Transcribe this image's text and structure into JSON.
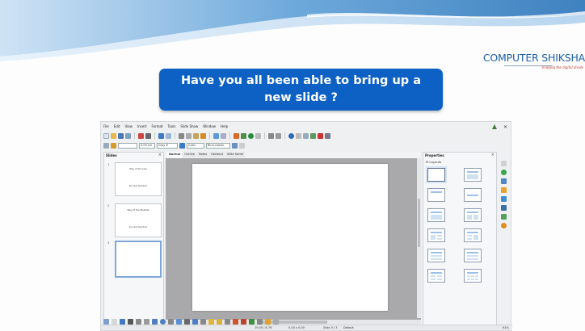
{
  "branding": {
    "name": "COMPUTER SHIKSHA",
    "tagline": "bridging the digital divide"
  },
  "banner": {
    "line1": "Have you all been able to bring up a",
    "line2": "new slide ?"
  },
  "app": {
    "menu": [
      "File",
      "Edit",
      "View",
      "Insert",
      "Format",
      "Tools",
      "Slide Show",
      "Window",
      "Help"
    ],
    "toolbar2": {
      "line_width": "0.00 cm",
      "line_color": "Gray 6",
      "fill_type": "Color",
      "fill_color": "Blue classic"
    },
    "slides_pane": {
      "title": "Slides",
      "slides": [
        {
          "num": "1",
          "title": "Way of Success",
          "subtitle": "by Last Gardner"
        },
        {
          "num": "2",
          "title": "Way of the Website",
          "subtitle": "by Last Gardner"
        },
        {
          "num": "3"
        }
      ]
    },
    "view_tabs": [
      "Normal",
      "Outline",
      "Notes",
      "Handout",
      "Slide Sorter"
    ],
    "properties": {
      "title": "Properties",
      "section": "Layouts"
    },
    "status": {
      "position": "19.05 / 8.76",
      "size": "0.00 x 0.00",
      "slide": "Slide 3 / 3",
      "layout_name": "Default",
      "zoom": "81%"
    }
  },
  "colors": {
    "banner": "#0d61c4",
    "brand": "#1c5fa8",
    "wave_dark": "#4d8ec7",
    "wave_light": "#a8ccec"
  }
}
